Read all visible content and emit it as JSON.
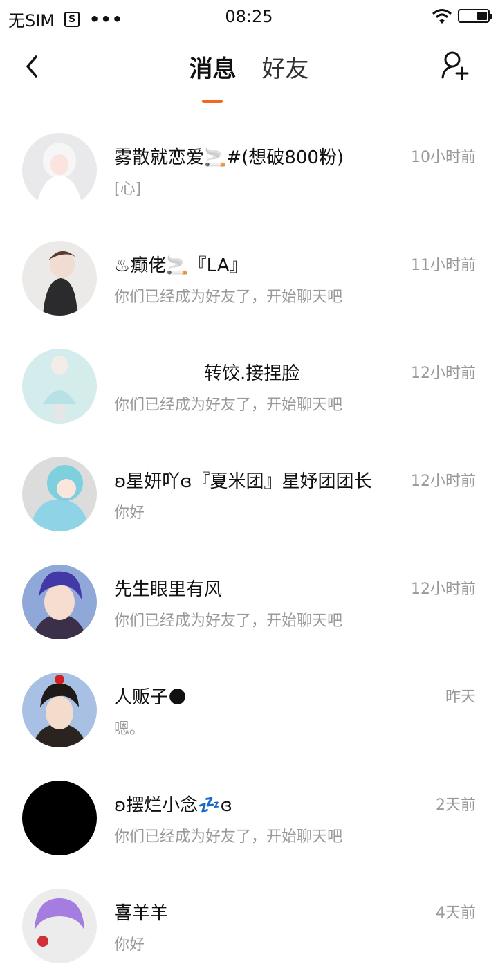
{
  "status_bar": {
    "carrier": "无SIM",
    "sim_icon_glyph": "S",
    "dots": "•••",
    "time": "08:25"
  },
  "nav": {
    "tabs": [
      {
        "label": "消息",
        "active": true
      },
      {
        "label": "好友",
        "active": false
      }
    ],
    "accent_color": "#f26a1b"
  },
  "messages": [
    {
      "name": "雾散就恋爱🚬#(想破800粉)",
      "preview": "[心]",
      "time": "10小时前",
      "avatar_bg": "#e9e9ec"
    },
    {
      "name": "♨癫佬🚬『LA』",
      "preview": "你们已经成为好友了，开始聊天吧",
      "time": "11小时前",
      "avatar_bg": "#d8d2cf"
    },
    {
      "name": "　　　　　转饺.接捏脸",
      "preview": "你们已经成为好友了，开始聊天吧",
      "time": "12小时前",
      "avatar_bg": "#cfe6e6"
    },
    {
      "name": "ʚ星妍吖ɞ『夏米团』星妤团团长",
      "preview": "你好",
      "time": "12小时前",
      "avatar_bg": "#bfe3ec"
    },
    {
      "name": "先生眼里有风",
      "preview": "你们已经成为好友了，开始聊天吧",
      "time": "12小时前",
      "avatar_bg": "#8fa8d8"
    },
    {
      "name": "人贩子🌑",
      "preview": "嗯。",
      "time": "昨天",
      "avatar_bg": "#9fb6dd"
    },
    {
      "name": "ʚ摆烂小念💤ɞ",
      "preview": "你们已经成为好友了，开始聊天吧",
      "time": "2天前",
      "avatar_bg": "#000000"
    },
    {
      "name": "喜羊羊",
      "preview": "你好",
      "time": "4天前",
      "avatar_bg": "#b79fe0"
    }
  ]
}
